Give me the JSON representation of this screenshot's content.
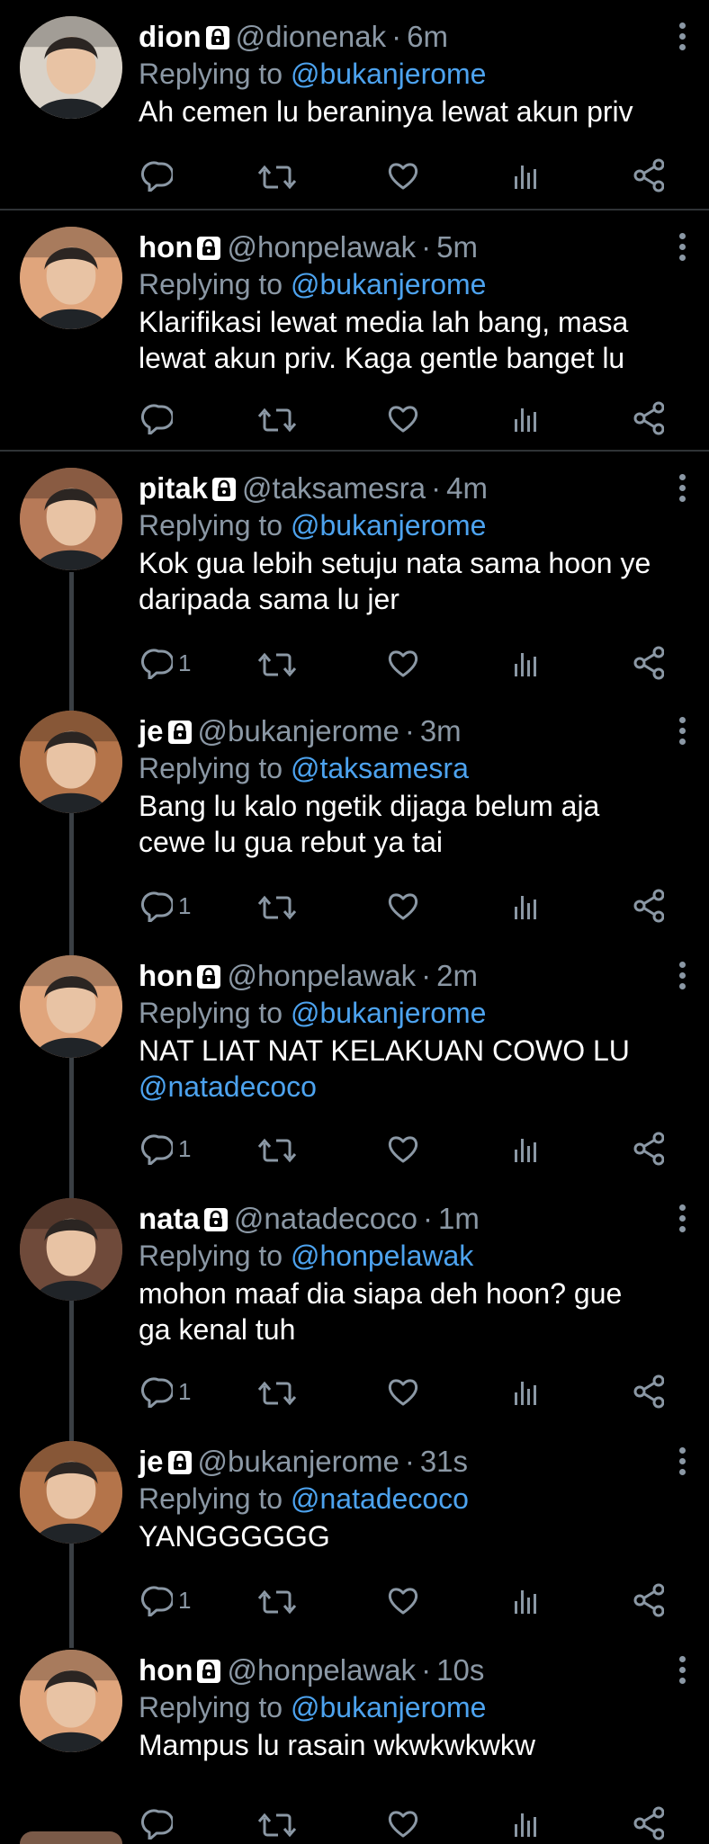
{
  "tweets": [
    {
      "name": "dion",
      "handle": "@dionenak",
      "time": "6m",
      "reply_prefix": "Replying to",
      "reply_to": "@bukanjerome",
      "lines": [
        "Ah cemen lu beraninya lewat akun priv"
      ],
      "mention": "",
      "reply_count": "",
      "avatar_color": "#d9d2c8"
    },
    {
      "name": "hon",
      "handle": "@honpelawak",
      "time": "5m",
      "reply_prefix": "Replying to",
      "reply_to": "@bukanjerome",
      "lines": [
        "Klarifikasi lewat media lah bang, masa",
        "lewat akun priv. Kaga gentle banget lu"
      ],
      "mention": "",
      "reply_count": "",
      "avatar_color": "#e0a57c"
    },
    {
      "name": "pitak",
      "handle": "@taksamesra",
      "time": "4m",
      "reply_prefix": "Replying to",
      "reply_to": "@bukanjerome",
      "lines": [
        "Kok gua lebih setuju nata sama hoon ye",
        "daripada sama lu jer"
      ],
      "mention": "",
      "reply_count": "1",
      "avatar_color": "#b77a58"
    },
    {
      "name": "je",
      "handle": "@bukanjerome",
      "time": "3m",
      "reply_prefix": "Replying to",
      "reply_to": "@taksamesra",
      "lines": [
        "Bang lu kalo ngetik dijaga belum aja",
        "cewe lu gua rebut ya tai"
      ],
      "mention": "",
      "reply_count": "1",
      "avatar_color": "#b4744a"
    },
    {
      "name": "hon",
      "handle": "@honpelawak",
      "time": "2m",
      "reply_prefix": "Replying to",
      "reply_to": "@bukanjerome",
      "lines": [
        "NAT LIAT NAT KELAKUAN COWO LU"
      ],
      "mention": "@natadecoco",
      "reply_count": "1",
      "avatar_color": "#e0a57c"
    },
    {
      "name": "nata",
      "handle": "@natadecoco",
      "time": "1m",
      "reply_prefix": "Replying to",
      "reply_to": "@honpelawak",
      "lines": [
        "mohon maaf dia siapa deh hoon? gue",
        "ga kenal tuh"
      ],
      "mention": "",
      "reply_count": "1",
      "avatar_color": "#6f4a3a"
    },
    {
      "name": "je",
      "handle": "@bukanjerome",
      "time": "31s",
      "reply_prefix": "Replying to",
      "reply_to": "@natadecoco",
      "lines": [
        "YANGGGGGG"
      ],
      "mention": "",
      "reply_count": "1",
      "avatar_color": "#b4744a"
    },
    {
      "name": "hon",
      "handle": "@honpelawak",
      "time": "10s",
      "reply_prefix": "Replying to",
      "reply_to": "@bukanjerome",
      "lines": [
        "Mampus lu rasain wkwkwkwkw"
      ],
      "mention": "",
      "reply_count": "",
      "avatar_color": "#e0a57c"
    }
  ],
  "separator": "·",
  "colors": {
    "background": "#000000",
    "text": "#ffffff",
    "muted": "#8b98a5",
    "link": "#4da3ef",
    "divider": "#2f3336"
  },
  "icons": [
    "lock-icon",
    "more-vertical-icon",
    "reply-icon",
    "retweet-icon",
    "like-icon",
    "analytics-icon",
    "share-icon"
  ]
}
